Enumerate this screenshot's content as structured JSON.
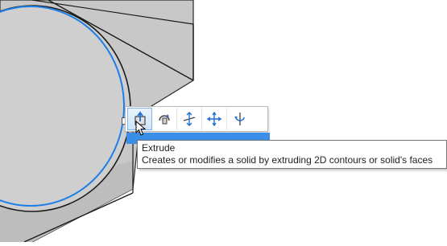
{
  "viewport": {
    "background": "#ffffff",
    "model_fill": "#c8c8c8",
    "contour_color": "#1e7fe6"
  },
  "toolbar": {
    "buttons": [
      {
        "name": "extrude",
        "icon": "extrude-icon",
        "active": true
      },
      {
        "name": "revolve",
        "icon": "revolve-icon",
        "active": false
      },
      {
        "name": "move-plane",
        "icon": "move-plane-icon",
        "active": false
      },
      {
        "name": "move",
        "icon": "move-arrows-icon",
        "active": false
      },
      {
        "name": "rotate",
        "icon": "rotate-axis-icon",
        "active": false
      }
    ]
  },
  "tooltip": {
    "title": "Extrude",
    "description": "Creates or modifies a solid by extruding 2D contours or solid's faces"
  },
  "colors": {
    "accent": "#3b8ee8",
    "highlight_border": "#7eb4ea"
  }
}
